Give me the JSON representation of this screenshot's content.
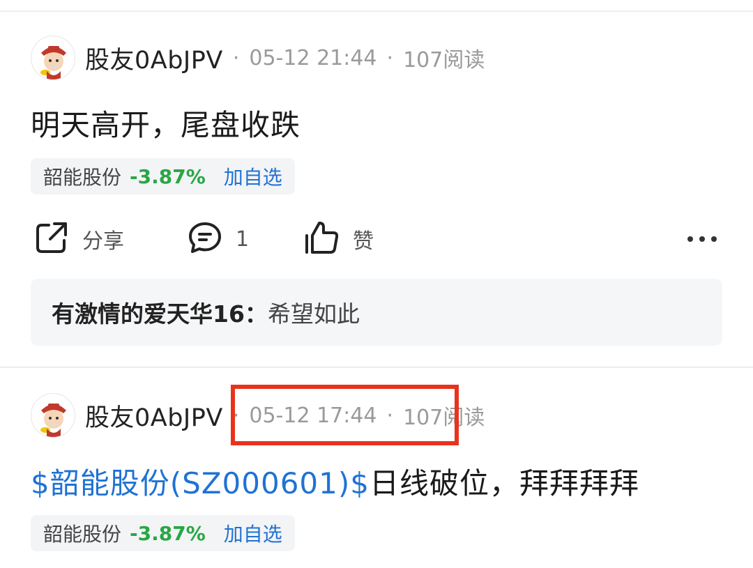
{
  "posts": [
    {
      "username": "股友0AbJPV",
      "separator": "·",
      "time": "05-12 21:44",
      "reads": "107阅读",
      "content_text": "明天高开，尾盘收跌",
      "stock_chip": {
        "name": "韶能股份",
        "change": "-3.87%",
        "add_label": "加自选",
        "change_color": "#28a745"
      },
      "actions": {
        "share_label": "分享",
        "comment_count": "1",
        "like_label": "赞"
      },
      "comment": {
        "author": "有激情的爱天华16：",
        "text": "希望如此"
      }
    },
    {
      "username": "股友0AbJPV",
      "separator": "·",
      "time": "05-12 17:44",
      "reads": "107阅读",
      "content_link": "$韶能股份(SZ000601)$",
      "content_text": "日线破位，拜拜拜拜",
      "stock_chip": {
        "name": "韶能股份",
        "change": "-3.87%",
        "add_label": "加自选",
        "change_color": "#28a745"
      }
    }
  ],
  "colors": {
    "link": "#1f72d4",
    "highlight_border": "#e8321e",
    "stock_down": "#28a745"
  },
  "icons": [
    "avatar-caishen",
    "share-icon",
    "comment-icon",
    "like-icon",
    "more-icon"
  ]
}
